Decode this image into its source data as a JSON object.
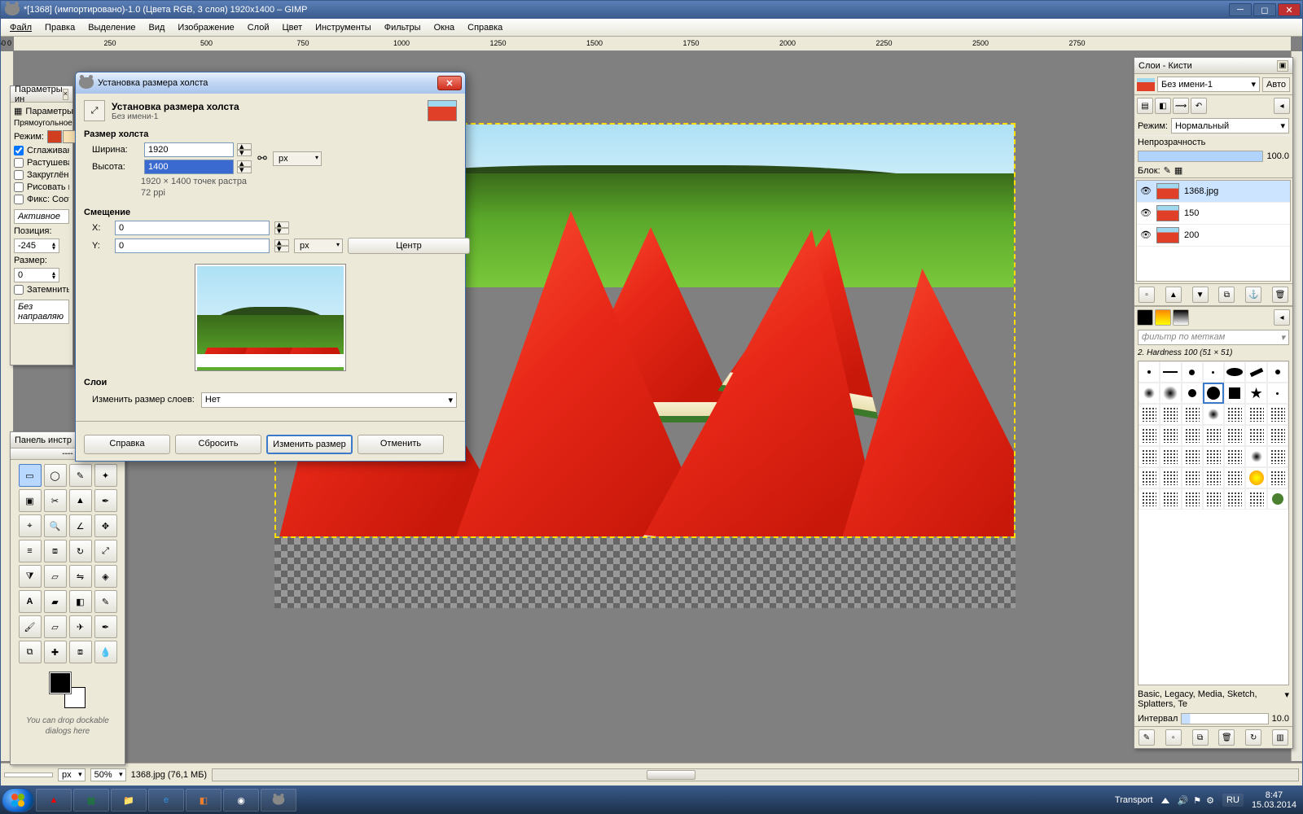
{
  "app": {
    "title": "*[1368] (импортировано)-1.0 (Цвета RGB, 3 слоя) 1920x1400 – GIMP"
  },
  "menu": {
    "file": "Файл",
    "edit": "Правка",
    "select": "Выделение",
    "view": "Вид",
    "image": "Изображение",
    "layer": "Слой",
    "colors": "Цвет",
    "tools": "Инструменты",
    "filters": "Фильтры",
    "windows": "Окна",
    "help": "Справка"
  },
  "ruler": {
    "ticks": [
      "0",
      "250",
      "500",
      "750",
      "1000",
      "1250",
      "1500",
      "1750",
      "2000",
      "2250",
      "2500",
      "2750"
    ]
  },
  "tool_options": {
    "title": "Параметры ин",
    "tab": "Параметры",
    "section": "Прямоугольное",
    "mode": "Режим:",
    "antialias": "Сглаживани",
    "feather": "Растушеват",
    "rounded": "Закруглённ",
    "expand": "Рисовать из",
    "fixed": "Фикс: Соот",
    "active": "Активное",
    "position": "Позиция:",
    "pos_val": "-245",
    "size": "Размер:",
    "size_val": "0",
    "highlight": "Затемнить н",
    "guides": "Без направляю"
  },
  "toolbox": {
    "title": "Панель инстр",
    "hint": "You can drop dockable dialogs here"
  },
  "layers": {
    "title": "Слои - Кисти",
    "image": "Без имени-1",
    "auto": "Авто",
    "mode_label": "Режим:",
    "mode_value": "Нормальный",
    "opacity_label": "Непрозрачность",
    "opacity_value": "100.0",
    "lock_label": "Блок:",
    "items": [
      {
        "name": "1368.jpg"
      },
      {
        "name": "150"
      },
      {
        "name": "200"
      }
    ]
  },
  "brushes": {
    "filter_placeholder": "фильтр по меткам",
    "current": "2. Hardness 100 (51 × 51)",
    "categories": "Basic, Legacy, Media, Sketch, Splatters, Te",
    "spacing_label": "Интервал",
    "spacing_value": "10.0"
  },
  "dialog": {
    "win_title": "Установка размера холста",
    "title": "Установка размера холста",
    "subtitle": "Без имени-1",
    "size_label": "Размер холста",
    "width": "Ширина:",
    "width_val": "1920",
    "height": "Высота:",
    "height_val": "1400",
    "unit": "px",
    "res_line1": "1920 × 1400 точек растра",
    "res_line2": "72 ppi",
    "offset_label": "Смещение",
    "x": "X:",
    "x_val": "0",
    "y": "Y:",
    "y_val": "0",
    "center": "Центр",
    "layers_label": "Слои",
    "resize_layers": "Изменить размер слоев:",
    "resize_value": "Нет",
    "help": "Справка",
    "reset": "Сбросить",
    "apply": "Изменить размер",
    "cancel": "Отменить"
  },
  "status": {
    "unit": "px",
    "zoom": "50%",
    "file": "1368.jpg (76,1 МБ)"
  },
  "taskbar": {
    "transport": "Transport",
    "lang": "RU",
    "time": "8:47",
    "date": "15.03.2014"
  }
}
